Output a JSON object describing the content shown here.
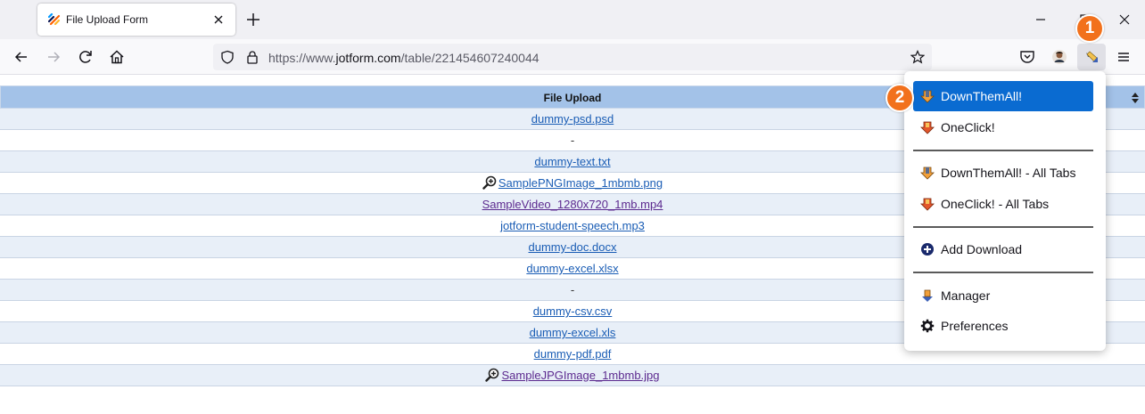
{
  "browser": {
    "tab_title": "File Upload Form",
    "url_scheme": "https://www.",
    "url_host": "jotform.com",
    "url_path": "/table/221454607240044"
  },
  "table": {
    "header": "File Upload",
    "rows": [
      {
        "text": "dummy-psd.psd",
        "kind": "link",
        "preview": false,
        "visited": false
      },
      {
        "text": "-",
        "kind": "empty",
        "preview": false,
        "visited": false
      },
      {
        "text": "dummy-text.txt",
        "kind": "link",
        "preview": false,
        "visited": false
      },
      {
        "text": "SamplePNGImage_1mbmb.png",
        "kind": "link",
        "preview": true,
        "visited": false
      },
      {
        "text": "SampleVideo_1280x720_1mb.mp4",
        "kind": "link",
        "preview": false,
        "visited": true
      },
      {
        "text": "jotform-student-speech.mp3",
        "kind": "link",
        "preview": false,
        "visited": false
      },
      {
        "text": "dummy-doc.docx",
        "kind": "link",
        "preview": false,
        "visited": false
      },
      {
        "text": "dummy-excel.xlsx",
        "kind": "link",
        "preview": false,
        "visited": false
      },
      {
        "text": "-",
        "kind": "empty",
        "preview": false,
        "visited": false
      },
      {
        "text": "dummy-csv.csv",
        "kind": "link",
        "preview": false,
        "visited": false
      },
      {
        "text": "dummy-excel.xls",
        "kind": "link",
        "preview": false,
        "visited": false
      },
      {
        "text": "dummy-pdf.pdf",
        "kind": "link",
        "preview": false,
        "visited": false
      },
      {
        "text": "SampleJPGImage_1mbmb.jpg",
        "kind": "link",
        "preview": true,
        "visited": true
      }
    ]
  },
  "menu": {
    "items": [
      {
        "label": "DownThemAll!",
        "icon": "downthemall-icon",
        "active": true
      },
      {
        "label": "OneClick!",
        "icon": "oneclick-icon",
        "active": false
      },
      {
        "label": "DownThemAll! - All Tabs",
        "icon": "downthemall-icon",
        "active": false
      },
      {
        "label": "OneClick! - All Tabs",
        "icon": "oneclick-icon",
        "active": false
      },
      {
        "label": "Add Download",
        "icon": "add-circle-icon",
        "active": false
      },
      {
        "label": "Manager",
        "icon": "manager-icon",
        "active": false
      },
      {
        "label": "Preferences",
        "icon": "gear-icon",
        "active": false
      }
    ]
  },
  "callouts": {
    "first": "1",
    "second": "2"
  },
  "colors": {
    "accent": "#0a6bd1",
    "callout": "#f2711c",
    "table_header": "#a3c2e8",
    "link": "#1a5db5",
    "visited_link": "#5c2a8f"
  }
}
